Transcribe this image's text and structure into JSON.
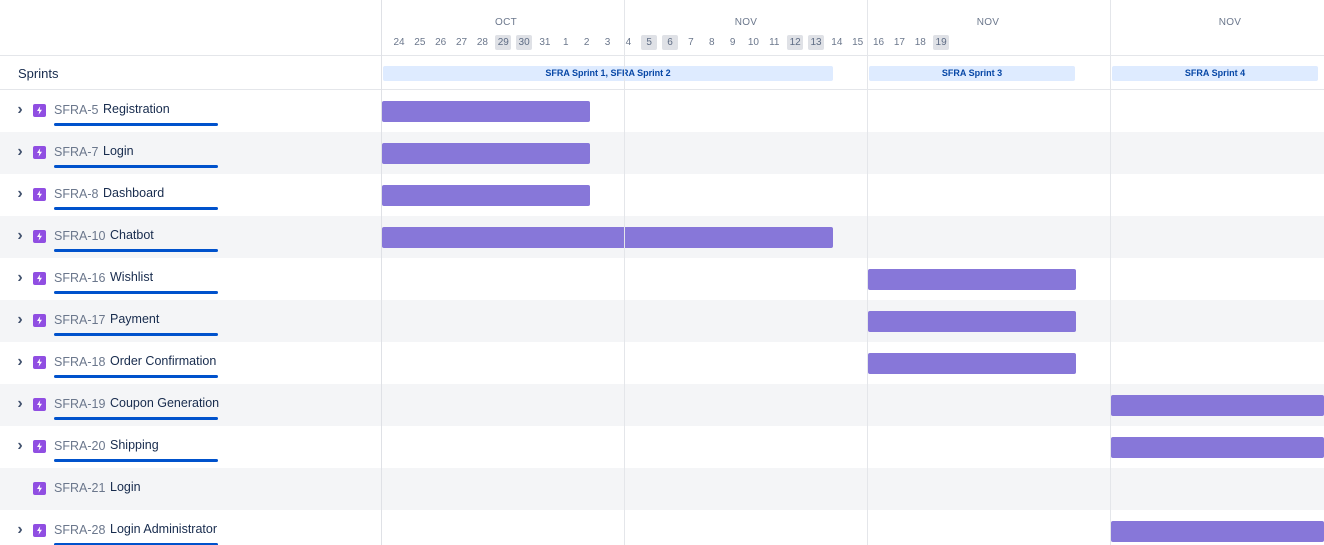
{
  "timeline": {
    "months": [
      "OCT",
      "NOV",
      "NOV",
      "NOV"
    ],
    "days": [
      "24",
      "25",
      "26",
      "27",
      "28",
      "29",
      "30",
      "31",
      "1",
      "2",
      "3",
      "4",
      "5",
      "6",
      "7",
      "8",
      "9",
      "10",
      "11",
      "12",
      "13",
      "14",
      "15",
      "16",
      "17",
      "18",
      "19"
    ],
    "weekend_days": [
      "29",
      "30",
      "5",
      "6",
      "12",
      "13",
      "19"
    ]
  },
  "left_panel": {
    "sprints_label": "Sprints"
  },
  "sprints": [
    {
      "label": "SFRA Sprint 1, SFRA Sprint 2"
    },
    {
      "label": "SFRA Sprint 3"
    },
    {
      "label": "SFRA Sprint 4"
    }
  ],
  "issues": [
    {
      "key": "SFRA-5",
      "title": "Registration",
      "has_children": true,
      "progress_pct": 100
    },
    {
      "key": "SFRA-7",
      "title": "Login",
      "has_children": true,
      "progress_pct": 100
    },
    {
      "key": "SFRA-8",
      "title": "Dashboard",
      "has_children": true,
      "progress_pct": 100
    },
    {
      "key": "SFRA-10",
      "title": "Chatbot",
      "has_children": true,
      "progress_pct": 100
    },
    {
      "key": "SFRA-16",
      "title": "Wishlist",
      "has_children": true,
      "progress_pct": 100
    },
    {
      "key": "SFRA-17",
      "title": "Payment",
      "has_children": true,
      "progress_pct": 100
    },
    {
      "key": "SFRA-18",
      "title": "Order Confirmation",
      "has_children": true,
      "progress_pct": 100
    },
    {
      "key": "SFRA-19",
      "title": "Coupon Generation",
      "has_children": true,
      "progress_pct": 100
    },
    {
      "key": "SFRA-20",
      "title": "Shipping",
      "has_children": true,
      "progress_pct": 100
    },
    {
      "key": "SFRA-21",
      "title": "Login",
      "has_children": false,
      "progress_pct": null
    },
    {
      "key": "SFRA-28",
      "title": "Login Administrator",
      "has_children": true,
      "progress_pct": 100
    }
  ],
  "colors": {
    "bar": "#8777d9",
    "epic_icon": "#904ee2",
    "progress": "#0052cc",
    "sprint_pill_bg": "#deebff",
    "sprint_pill_text": "#0747a6",
    "alt_row": "#f4f5f7"
  },
  "icons": {
    "expand": "chevron-right-icon",
    "issue_type": "epic-lightning-icon"
  }
}
